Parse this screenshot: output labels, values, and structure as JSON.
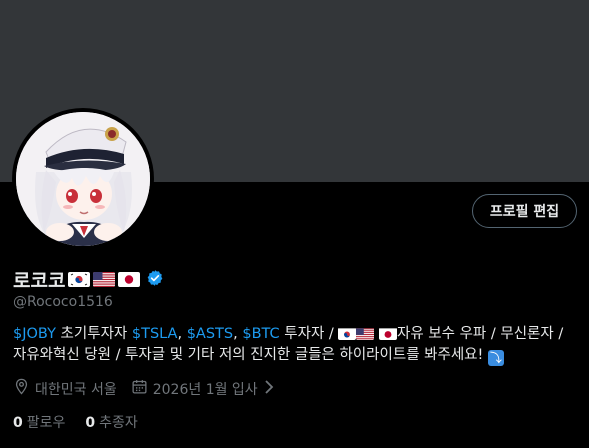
{
  "profile": {
    "display_name": "로코코",
    "handle": "@Rococo1516",
    "edit_button": "프로필 편집",
    "name_flags": [
      "korea-flag",
      "usa-flag",
      "japan-flag"
    ],
    "verified_icon": "verified-badge-icon",
    "bio": {
      "line1_parts": {
        "joby": "$JOBY",
        "t1": " 초기투자자 ",
        "tsla": "$TSLA",
        "comma1": ", ",
        "asts": "$ASTS",
        "comma2": ", ",
        "btc": "$BTC",
        "t2": " 투자자 / ",
        "t3": "자유 보수 우파 / 무신론자 /"
      },
      "line2": "자유와혁신 당원 / 투자글 및 기타 저의 진지한 글들은 하이라이트를 봐주세요! ",
      "arrow_emoji": "⤵"
    },
    "location": "대한민국 서울",
    "joined": "2026년 1월 입사",
    "following_count": "0",
    "following_label": "팔로우",
    "followers_count": "0",
    "followers_label": "추종자"
  },
  "colors": {
    "background": "#000000",
    "banner": "#333639",
    "link": "#1d9bf0",
    "text_primary": "#e7e9ea",
    "text_secondary": "#71767b",
    "button_border": "#536471",
    "verified": "#1d9bf0"
  }
}
